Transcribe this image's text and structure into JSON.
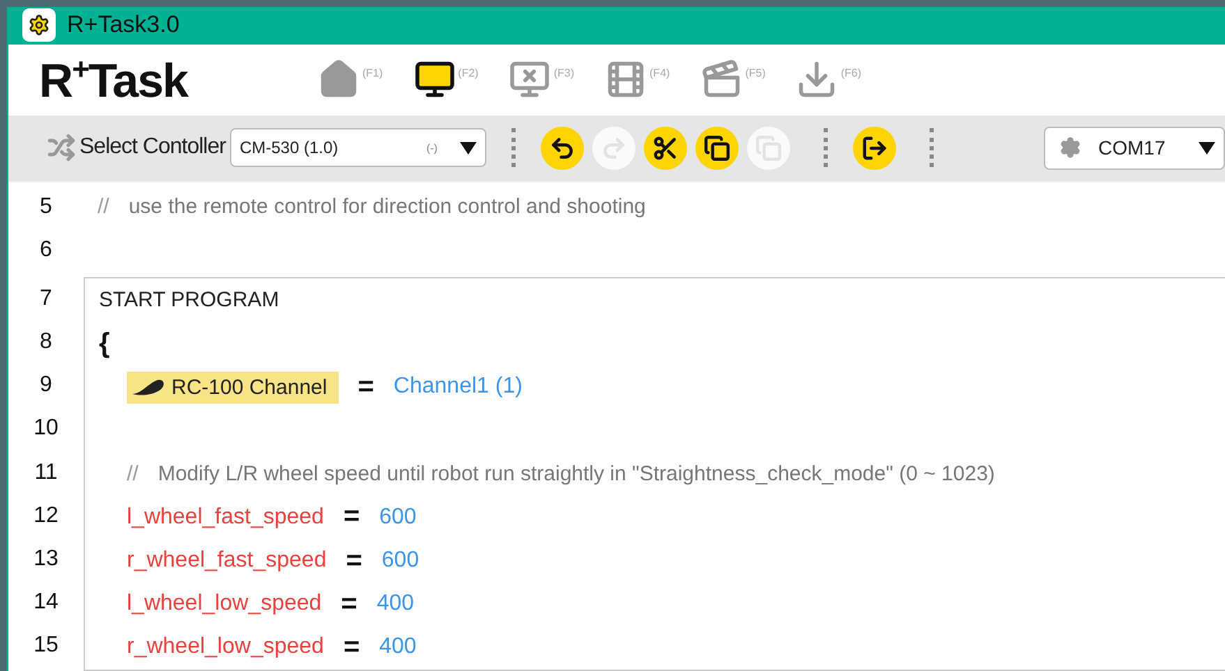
{
  "window": {
    "title": "R+Task3.0"
  },
  "logo": "R$^{+}$Task",
  "modes": [
    {
      "kind": "home",
      "key": "(F1)",
      "selected": false
    },
    {
      "kind": "code",
      "key": "(F2)",
      "selected": true
    },
    {
      "kind": "alert",
      "key": "(F3)",
      "selected": false
    },
    {
      "kind": "film",
      "key": "(F4)",
      "selected": false
    },
    {
      "kind": "clapper",
      "key": "(F5)",
      "selected": false
    },
    {
      "kind": "download",
      "key": "(F6)",
      "selected": false
    }
  ],
  "controller": {
    "label": "Select Contoller",
    "value": "CM-530 (1.0)",
    "version": "(-)"
  },
  "edit_buttons": [
    {
      "kind": "undo",
      "disabled": false
    },
    {
      "kind": "redo",
      "disabled": true
    },
    {
      "kind": "cut",
      "disabled": false
    },
    {
      "kind": "copy",
      "disabled": false
    },
    {
      "kind": "paste",
      "disabled": true
    }
  ],
  "exit_button": {
    "kind": "exit",
    "disabled": false
  },
  "port": {
    "value": "COM17"
  },
  "pre_lines": [
    {
      "number": "5",
      "kind": "comment",
      "mark": "//",
      "text": "use the remote control for direction control and shooting"
    },
    {
      "number": "6",
      "kind": "blank"
    }
  ],
  "program_lines": [
    {
      "number": "7",
      "kind": "keyword",
      "text": "START PROGRAM"
    },
    {
      "number": "8",
      "kind": "brace",
      "text": "{"
    },
    {
      "number": "9",
      "kind": "device",
      "text": "RC-100 Channel",
      "op": "=",
      "value": "Channel1 (1)"
    },
    {
      "number": "10",
      "kind": "blank"
    },
    {
      "number": "11",
      "kind": "comment",
      "mark": "//",
      "text": "Modify L/R wheel speed until robot run straightly in \"Straightness_check_mode\"  (0 ~ 1023)"
    },
    {
      "number": "12",
      "kind": "assign",
      "text": "l_wheel_fast_speed",
      "op": "=",
      "value": "600"
    },
    {
      "number": "13",
      "kind": "assign",
      "text": "r_wheel_fast_speed",
      "op": "=",
      "value": "600"
    },
    {
      "number": "14",
      "kind": "assign",
      "text": "l_wheel_low_speed",
      "op": "=",
      "value": "400"
    },
    {
      "number": "15",
      "kind": "assign",
      "text": "r_wheel_low_speed",
      "op": "=",
      "value": "400"
    }
  ]
}
